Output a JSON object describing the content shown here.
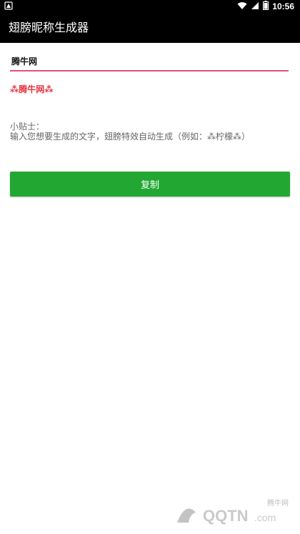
{
  "status_bar": {
    "time": "10:56"
  },
  "app_bar": {
    "title": "翅膀昵称生成器"
  },
  "input": {
    "value": "腾牛网"
  },
  "preview": {
    "text": "⁂腾牛网⁂"
  },
  "tip": {
    "title": "小贴士：",
    "body": "输入您想要生成的文字，翅膀特效自动生成（例如：⁂柠檬⁂）"
  },
  "copy_button": {
    "label": "复制"
  },
  "watermark": {
    "site_name": "腾牛网",
    "logo_text": "QQTN.com"
  },
  "colors": {
    "bar": "#000000",
    "accent_line": "#e0507a",
    "preview_text": "#e8333f",
    "button": "#22a832"
  }
}
